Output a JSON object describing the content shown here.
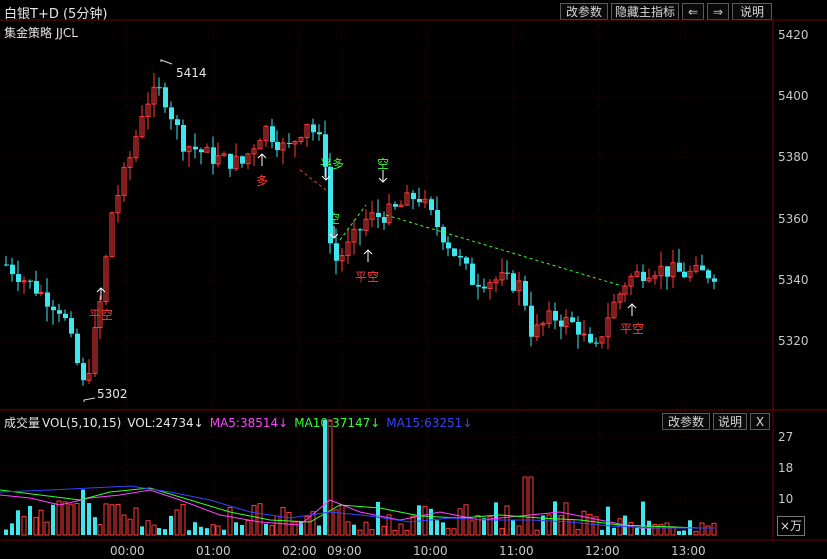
{
  "header": {
    "title": "白银T+D (5分钟)",
    "strategy": "集金策略 JJCL",
    "buttons": [
      "改参数",
      "隐藏主指标",
      "⇐",
      "⇒",
      "说明"
    ]
  },
  "price_axis": [
    "5420",
    "5400",
    "5380",
    "5360",
    "5340",
    "5320"
  ],
  "price_high_label": "5414",
  "price_low_label": "5302",
  "signals": [
    {
      "text": "平空",
      "color": "#ff3b3b"
    },
    {
      "text": "多",
      "color": "#ff3b3b"
    },
    {
      "text": "平多",
      "color": "#33ff33"
    },
    {
      "text": "空",
      "color": "#33ff33"
    },
    {
      "text": "空",
      "color": "#33ff33"
    },
    {
      "text": "平空",
      "color": "#ff3b3b"
    },
    {
      "text": "平空",
      "color": "#ff3b3b"
    }
  ],
  "volume_panel": {
    "name": "成交量",
    "indicator": "VOL(5,10,15)",
    "vol": "VOL:24734↓",
    "ma5": "MA5:38514↓",
    "ma10": "MA10:37147↓",
    "ma15": "MA15:63251↓",
    "buttons": [
      "改参数",
      "说明",
      "X"
    ],
    "axis": [
      "27",
      "18",
      "10"
    ],
    "unit": "×万",
    "colors": {
      "ma5": "#ff44ff",
      "ma10": "#33ff33",
      "ma15": "#3344ff"
    }
  },
  "time_axis": [
    "00:00",
    "01:00",
    "02:00",
    "09:00",
    "10:00",
    "11:00",
    "12:00",
    "13:00"
  ],
  "colors": {
    "up": "#ff3b3b",
    "down": "#3ee6ee",
    "background": "#000000",
    "grid": "#3a0000"
  }
}
